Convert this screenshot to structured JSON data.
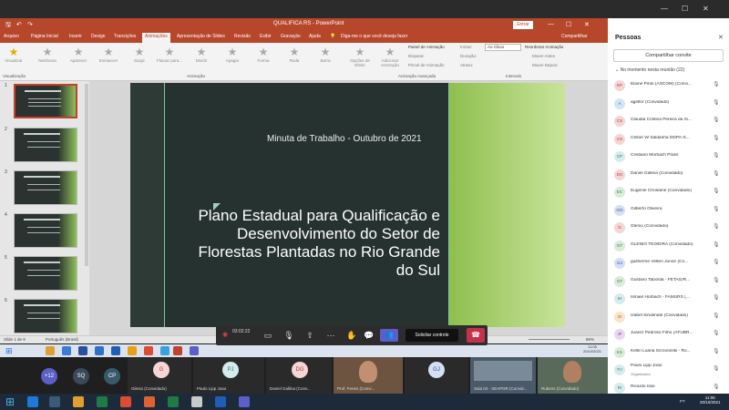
{
  "ppt": {
    "title": "QUALIFICA RS  -  PowerPoint",
    "search_placeholder": "Diga-me o que você deseja fazer",
    "signin": "Entrar",
    "share": "Compartilhar",
    "tabs": [
      "Arquivo",
      "Página Inicial",
      "Inserir",
      "Design",
      "Transições",
      "Animações",
      "Apresentação de Slides",
      "Revisão",
      "Exibir",
      "Gravação",
      "Ajuda"
    ],
    "active_tab": "Animações",
    "ribbon": {
      "preview": "Visualizar",
      "effects": [
        "Nenhuma",
        "Aparecer",
        "Esmaecer",
        "Surgir",
        "Flutuar para...",
        "Dividir",
        "Apagar",
        "Forma",
        "Roda",
        "Barra"
      ],
      "effect_options": "Opções de Efeito",
      "add_animation": "Adicionar Animação",
      "animation_panel": "Painel de Animação",
      "trigger": "Disparar",
      "painter": "Pincel de Animação",
      "start_label": "Iniciar:",
      "start_value": "Ao Clicar",
      "duration_label": "Duração:",
      "delay_label": "Atraso:",
      "reorder": "Reordenar Animação",
      "move_earlier": "Mover Antes",
      "move_later": "Mover Depois",
      "group_preview": "Visualização",
      "group_animation": "Animação",
      "group_advanced": "Animação Avançada",
      "group_timing": "Intervalo"
    },
    "slide": {
      "subtitle": "Minuta de Trabalho - Outubro de 2021",
      "title": "Plano Estadual para Qualificação e Desenvolvimento do Setor de Florestas Plantadas no Rio Grande do Sul"
    },
    "thumb_numbers": [
      "1",
      "2",
      "3",
      "4",
      "5",
      "6"
    ],
    "status": {
      "slide": "Slide 1 de 9",
      "language": "Português (Brasil)",
      "zoom": "86%"
    }
  },
  "call": {
    "timer": "03:02:22",
    "request_control": "Solicitar controle"
  },
  "inner_clock": {
    "time": "11:05",
    "date": "20/10/2021"
  },
  "strip": {
    "overflow": "+12",
    "avatars": [
      "SQ",
      "CP"
    ],
    "tiles": [
      {
        "initials": "G",
        "name": "Glenio (Convidado)"
      },
      {
        "initials": "PJ",
        "name": "Paulo Lipp Joao"
      },
      {
        "initials": "DG",
        "name": "Daniel Gallina (Conv..."
      },
      {
        "initials": "",
        "name": "Prof. Fenes (Convi..."
      },
      {
        "initials": "GJ",
        "name": ""
      },
      {
        "initials": "",
        "name": "Sala 04 - SEAPDR (Convid..."
      },
      {
        "initials": "",
        "name": "Rubens (Convidado)"
      }
    ]
  },
  "panel": {
    "title": "Pessoas",
    "share_invite": "Compartilhar convite",
    "section": "No momento nesta reunião (22)",
    "people": [
      {
        "initials": "EP",
        "name": "Elaine Pinto (ASCOM) (Convi...",
        "bg": "#f6d5d5",
        "fg": "#b13a3a",
        "role": ""
      },
      {
        "initials": "A",
        "name": "agelfor (Convidado)",
        "bg": "#d3e6f5",
        "fg": "#2f6a9a",
        "role": ""
      },
      {
        "initials": "CS",
        "name": "Claudia Cristina Pereira da Si...",
        "bg": "#f6d5d5",
        "fg": "#b13a3a",
        "role": ""
      },
      {
        "initials": "CS",
        "name": "Cleber W Saldanha DDPA-S...",
        "bg": "#f6d5d5",
        "fg": "#b13a3a",
        "role": ""
      },
      {
        "initials": "CP",
        "name": "Cristiano Morbach Prass",
        "bg": "#d5ecec",
        "fg": "#2a7d7d",
        "role": ""
      },
      {
        "initials": "DG",
        "name": "Daniel Gallina (Convidado)",
        "bg": "#f6d5d5",
        "fg": "#b13a3a",
        "role": ""
      },
      {
        "initials": "EC",
        "name": "Eugenie Chosame (Convidado)",
        "bg": "#d8ecd8",
        "fg": "#3a7a3a",
        "role": ""
      },
      {
        "initials": "GO",
        "name": "Gilberto Oliveira",
        "bg": "#d3e0f5",
        "fg": "#2f4f9a",
        "role": ""
      },
      {
        "initials": "G",
        "name": "Glenio (Convidado)",
        "bg": "#f6d5d5",
        "fg": "#b13a3a",
        "role": ""
      },
      {
        "initials": "GT",
        "name": "GLENIO TEIXEIRA (Convidado)",
        "bg": "#d8ecd8",
        "fg": "#3a7a3a",
        "role": ""
      },
      {
        "initials": "GJ",
        "name": "guilherme Velten Junior (Co...",
        "bg": "#d3e0f5",
        "fg": "#2f4f9a",
        "role": ""
      },
      {
        "initials": "GT",
        "name": "Gustavo Taborda - FETAG/R...",
        "bg": "#d8ecd8",
        "fg": "#3a7a3a",
        "role": ""
      },
      {
        "initials": "IH",
        "name": "Ismael Horbach - FAMURS (...",
        "bg": "#d5ecec",
        "fg": "#2a7d7d",
        "role": ""
      },
      {
        "initials": "IS",
        "name": "Izabel Sindimate (Convidado)",
        "bg": "#f9e3c9",
        "fg": "#a4601d",
        "role": ""
      },
      {
        "initials": "JF",
        "name": "Juarez Pedroso Filho (AFUBR...",
        "bg": "#ead5f2",
        "fg": "#7a3a9a",
        "role": ""
      },
      {
        "initials": "KS",
        "name": "Kellin Luana Scrovonski - Ro...",
        "bg": "#d8ecd8",
        "fg": "#3a7a3a",
        "role": ""
      },
      {
        "initials": "PJ",
        "name": "Paulo Lipp Joao",
        "bg": "#d5ecec",
        "fg": "#2a7d7d",
        "role": "Organizador"
      },
      {
        "initials": "RI",
        "name": "Ricardo Isse",
        "bg": "#d5ecec",
        "fg": "#2a7d7d",
        "role": ""
      }
    ]
  },
  "taskbar": {
    "time": "11:05",
    "date": "20/10/2021",
    "lang": "PT"
  }
}
